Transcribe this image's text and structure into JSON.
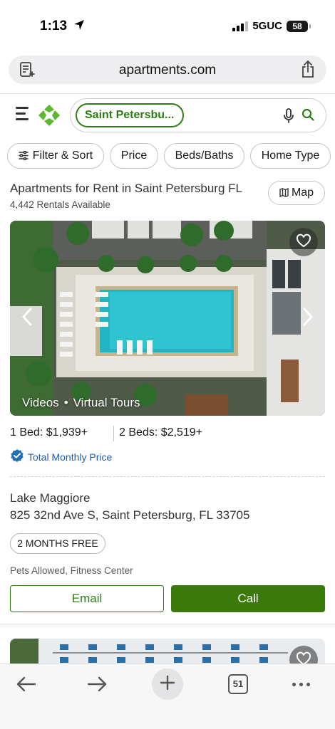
{
  "status_bar": {
    "time": "1:13",
    "network": "5GUC",
    "battery": "58"
  },
  "browser": {
    "url": "apartments.com",
    "tab_count": "51"
  },
  "search": {
    "location_chip": "Saint Petersbu..."
  },
  "filters": [
    {
      "label": "Filter & Sort"
    },
    {
      "label": "Price"
    },
    {
      "label": "Beds/Baths"
    },
    {
      "label": "Home Type"
    }
  ],
  "results": {
    "title": "Apartments for Rent in Saint Petersburg FL",
    "count": "4,442 Rentals Available",
    "map_label": "Map"
  },
  "listing": {
    "media_videos": "Videos",
    "media_separator": "•",
    "media_tours": "Virtual Tours",
    "price_1bed": "1 Bed: $1,939+",
    "price_2bed": "2 Beds: $2,519+",
    "total_monthly_price": "Total Monthly Price",
    "name": "Lake Maggiore",
    "address": "825 32nd Ave S, Saint Petersburg, FL 33705",
    "promo": "2 MONTHS FREE",
    "amenities": "Pets Allowed, Fitness Center",
    "email_label": "Email",
    "call_label": "Call"
  },
  "colors": {
    "brand_green": "#2e7d14",
    "call_button": "#3a7a0b",
    "link_blue": "#1f5fa8"
  },
  "icons": [
    "location-arrow-icon",
    "reader-icon",
    "share-icon",
    "hamburger-menu-icon",
    "logo-icon",
    "microphone-icon",
    "search-icon",
    "sliders-icon",
    "map-icon",
    "heart-icon",
    "chevron-left-icon",
    "chevron-right-icon",
    "verified-check-icon",
    "back-arrow-icon",
    "forward-arrow-icon",
    "plus-icon",
    "tabs-icon",
    "more-icon"
  ]
}
